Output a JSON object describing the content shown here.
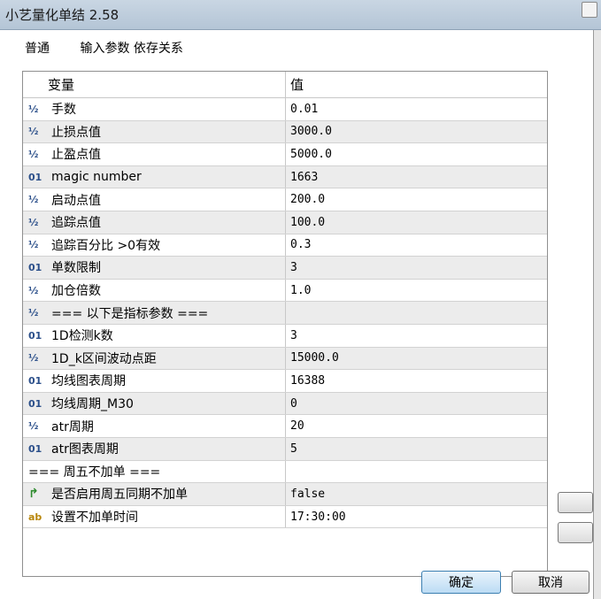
{
  "window": {
    "title": "小艺量化单结 2.58"
  },
  "tabs": [
    {
      "label": "普通"
    },
    {
      "label": "输入参数 依存关系"
    }
  ],
  "table": {
    "headers": {
      "name": "变量",
      "value": "值"
    },
    "rows": [
      {
        "icon": "½",
        "name": "手数",
        "value": "0.01"
      },
      {
        "icon": "½",
        "name": "止损点值",
        "value": "3000.0"
      },
      {
        "icon": "½",
        "name": "止盈点值",
        "value": "5000.0"
      },
      {
        "icon": "01",
        "name": "magic number",
        "value": "1663"
      },
      {
        "icon": "½",
        "name": "启动点值",
        "value": "200.0"
      },
      {
        "icon": "½",
        "name": "追踪点值",
        "value": "100.0"
      },
      {
        "icon": "½",
        "name": "追踪百分比 >0有效",
        "value": "0.3"
      },
      {
        "icon": "01",
        "name": "单数限制",
        "value": "3"
      },
      {
        "icon": "½",
        "name": "加仓倍数",
        "value": "1.0"
      },
      {
        "icon": "½",
        "name": "=== 以下是指标参数 ===",
        "value": ""
      },
      {
        "icon": "01",
        "name": "1D检测k数",
        "value": "3"
      },
      {
        "icon": "½",
        "name": "1D_k区间波动点距",
        "value": "15000.0"
      },
      {
        "icon": "01",
        "name": "均线图表周期",
        "value": "16388"
      },
      {
        "icon": "01",
        "name": "均线周期_M30",
        "value": "0"
      },
      {
        "icon": "½",
        "name": "atr周期",
        "value": "20"
      },
      {
        "icon": "01",
        "name": "atr图表周期",
        "value": "5"
      },
      {
        "icon": "",
        "name": "=== 周五不加单 ===",
        "value": ""
      },
      {
        "icon": "bool",
        "name": "是否启用周五同期不加单",
        "value": "false"
      },
      {
        "icon": "ab",
        "name": "设置不加单时间",
        "value": "17:30:00"
      }
    ]
  },
  "buttons": {
    "ok": "确定",
    "cancel": "取消"
  }
}
